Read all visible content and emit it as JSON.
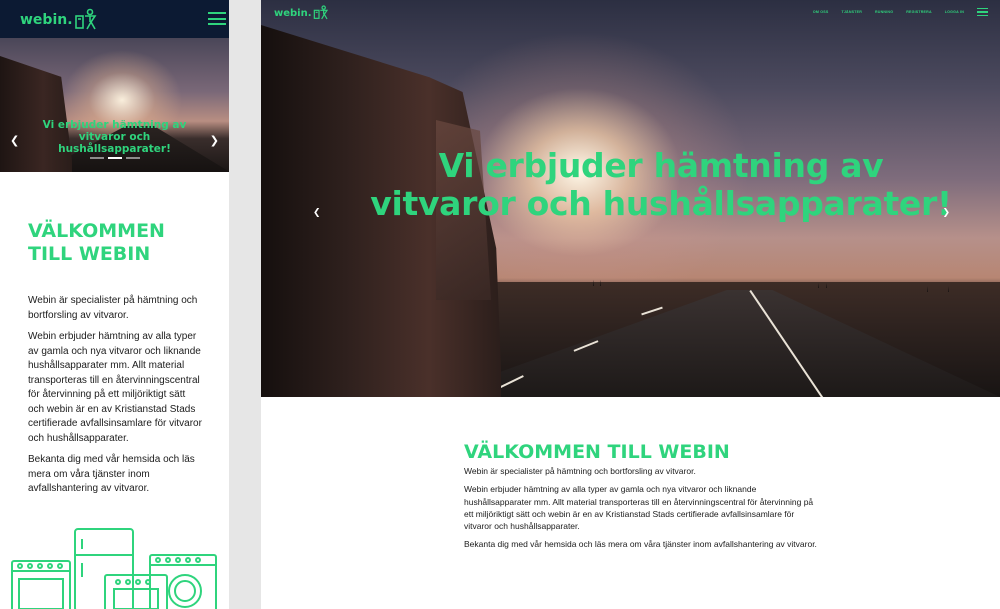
{
  "brand": {
    "name": "webin.",
    "accent": "#2fd47d",
    "header_bg": "#0c1a33"
  },
  "mobile": {
    "hero": {
      "title": "Vi erbjuder hämtning av vitvaror och hushållsapparater!"
    },
    "welcome": {
      "line1": "VÄLKOMMEN",
      "line2": "TILL WEBIN"
    },
    "paragraphs": [
      "Webin är specialister på hämtning och bortforsling av vitvaror.",
      "Webin erbjuder hämtning av alla typer av gamla och nya vitvaror och liknande hushållsapparater mm. Allt material transporteras till en återvinningscentral för återvinning på ett miljöriktigt sätt och webin är en av Kristianstad Stads certifierade avfallsinsamlare för vitvaror och hushållsapparater.",
      "Bekanta dig med vår hemsida och läs mera om våra tjänster inom avfallshantering av vitvaror."
    ],
    "carousel_active_index": 1
  },
  "desktop": {
    "nav": [
      "OM OSS",
      "TJÄNSTER",
      "RUNNING",
      "REGISTRERA",
      "LOGGA IN"
    ],
    "hero": {
      "title_line1": "Vi erbjuder hämtning av",
      "title_line2": "vitvaror och hushållsapparater!"
    },
    "welcome": "VÄLKOMMEN TILL WEBIN",
    "paragraphs": [
      "Webin är specialister på hämtning och bortforsling av vitvaror.",
      "Webin erbjuder hämtning av alla typer av gamla och nya vitvaror och liknande hushållsapparater mm. Allt material transporteras till en återvinningscentral för återvinning på ett miljöriktigt sätt och webin är en av Kristianstad Stads certifierade avfallsinsamlare för vitvaror och hushållsapparater.",
      "Bekanta dig med vår hemsida och läs mera om våra tjänster inom avfallshantering av vitvaror."
    ]
  },
  "icons": {
    "logo_mark": "appliance-figure-icon",
    "menu": "hamburger-menu-icon",
    "prev": "chevron-left-icon",
    "next": "chevron-right-icon",
    "illustration": "appliances-illustration"
  }
}
